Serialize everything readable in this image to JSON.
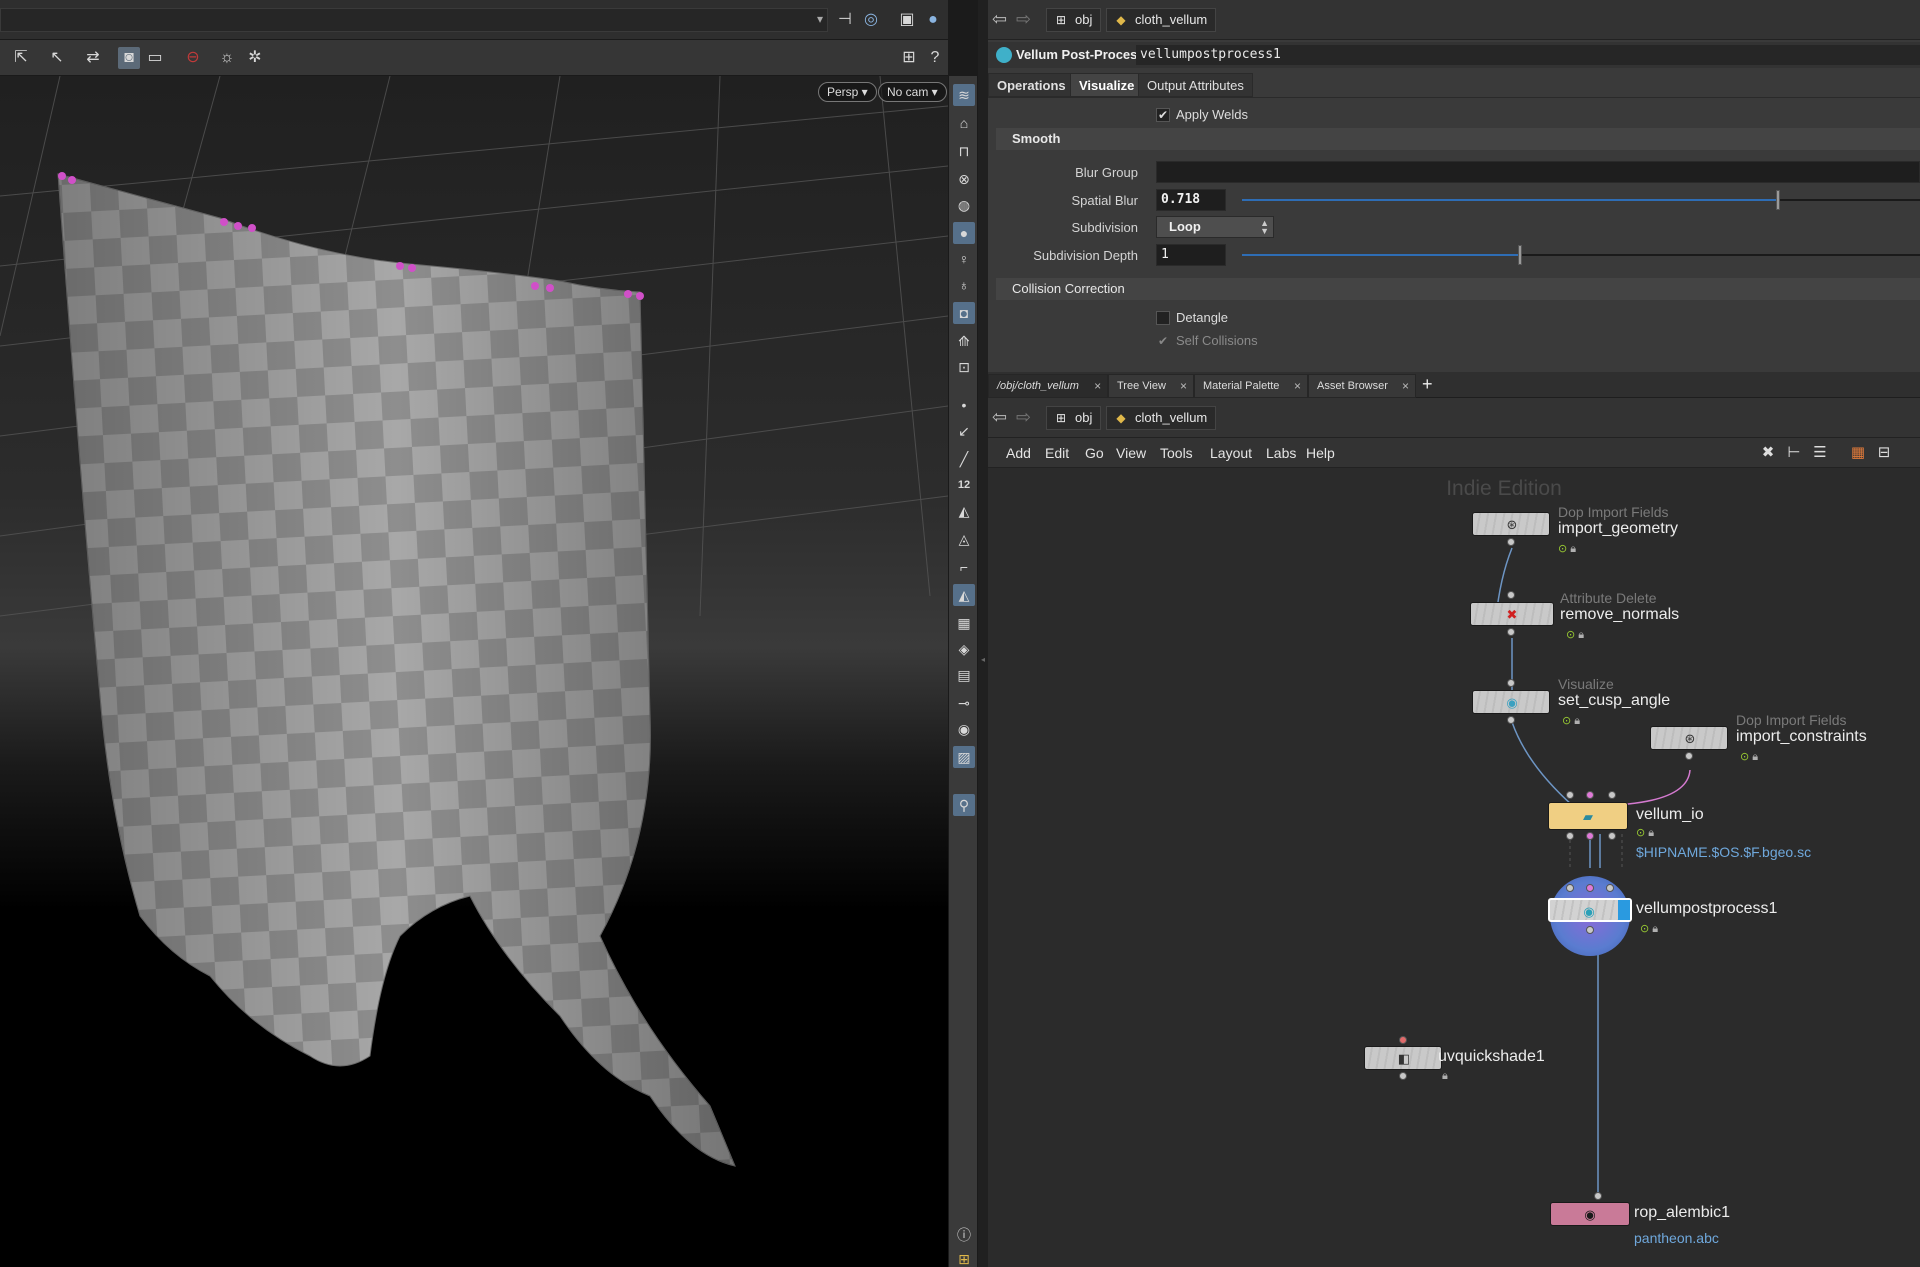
{
  "viewport": {
    "camera_persp": "Persp ▾",
    "camera_name": "No cam ▾",
    "top_icons": [
      "pin-icon",
      "target-icon",
      "box-icon",
      "sphere-icon",
      "square-icon"
    ],
    "toolbar_icons": [
      "select-icon",
      "select-arrow-icon",
      "transform-icon",
      "camera-icon",
      "display-icon",
      "ghost-icon",
      "snapshot-icon",
      "settings-icon"
    ]
  },
  "params": {
    "path": {
      "root": "obj",
      "object": "cloth_vellum"
    },
    "node_type": "Vellum Post-Process",
    "node_name": "vellumpostprocess1",
    "tabs": [
      "Operations",
      "Visualize",
      "Output Attributes"
    ],
    "apply_welds": {
      "label": "Apply Welds",
      "checked": true
    },
    "smooth_section": "Smooth",
    "blur_group": {
      "label": "Blur Group",
      "value": ""
    },
    "spatial_blur": {
      "label": "Spatial Blur",
      "value": "0.718",
      "fraction": 0.79
    },
    "subdivision": {
      "label": "Subdivision",
      "value": "Loop"
    },
    "subdivision_depth": {
      "label": "Subdivision Depth",
      "value": "1",
      "fraction": 0.41
    },
    "collision_section": "Collision Correction",
    "detangle": {
      "label": "Detangle",
      "checked": false
    },
    "self_collisions": {
      "label": "Self Collisions",
      "checked": true
    }
  },
  "network": {
    "pane_tabs": [
      {
        "label": "/obj/cloth_vellum",
        "active": true
      },
      {
        "label": "Tree View"
      },
      {
        "label": "Material Palette"
      },
      {
        "label": "Asset Browser"
      }
    ],
    "path": {
      "root": "obj",
      "object": "cloth_vellum"
    },
    "menu": [
      "Add",
      "Edit",
      "Go",
      "View",
      "Tools",
      "Layout",
      "Labs",
      "Help"
    ],
    "watermark": "Indie Edition",
    "nodes": {
      "import_geometry": {
        "type": "Dop Import Fields",
        "name": "import_geometry"
      },
      "remove_normals": {
        "type": "Attribute Delete",
        "name": "remove_normals"
      },
      "set_cusp_angle": {
        "type": "Visualize",
        "name": "set_cusp_angle"
      },
      "import_constraints": {
        "type": "Dop Import Fields",
        "name": "import_constraints"
      },
      "vellum_io": {
        "name": "vellum_io",
        "extra": "$HIPNAME.$OS.$F.bgeo.sc"
      },
      "vellumpostprocess1": {
        "name": "vellumpostprocess1"
      },
      "uvquickshade1": {
        "name": "uvquickshade1"
      },
      "rop_alembic1": {
        "name": "rop_alembic1",
        "extra": "pantheon.abc"
      }
    }
  }
}
